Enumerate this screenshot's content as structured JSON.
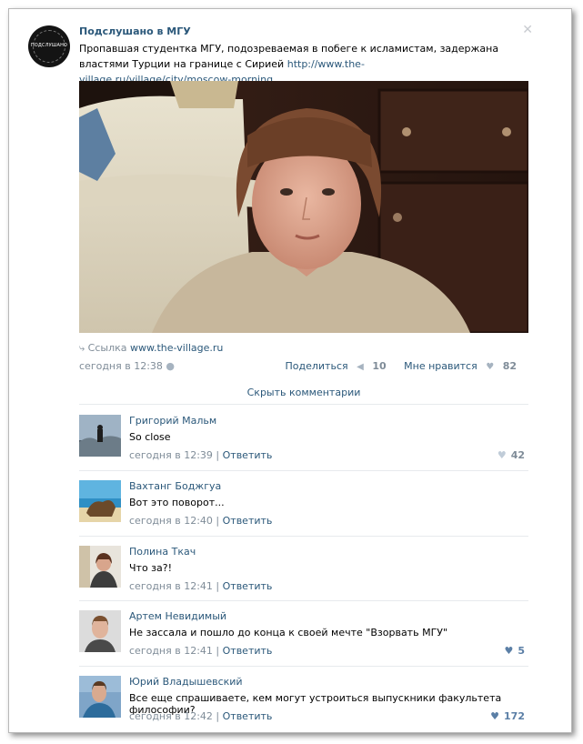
{
  "post": {
    "group_name": "Подслушано в МГУ",
    "avatar_text": "ПОДСЛУШАНО",
    "text": "Пропавшая студентка МГУ, подозреваемая в побеге к исламистам, задержана властями Турции на границе с Сирией ",
    "link_text": "http://www.the-village.ru/village/city/moscow-morning..",
    "link_label": "Ссылка",
    "link_domain": "www.the-village.ru",
    "time": "сегодня в 12:38",
    "share_label": "Поделиться",
    "share_count": "10",
    "like_label": "Мне нравится",
    "like_count": "82",
    "hide_comments": "Скрыть комментарии"
  },
  "comments": [
    {
      "author": "Григорий Мальм",
      "text": "So close",
      "time": "сегодня в 12:39",
      "reply": "Ответить",
      "likes": "42"
    },
    {
      "author": "Вахтанг Боджгуа",
      "text": "Вот это поворот...",
      "time": "сегодня в 12:40",
      "reply": "Ответить",
      "likes": ""
    },
    {
      "author": "Полина Ткач",
      "text": "Что за?!",
      "time": "сегодня в 12:41",
      "reply": "Ответить",
      "likes": ""
    },
    {
      "author": "Артем Невидимый",
      "text": "Не зассала и пошло до конца к своей мечте \"Взорвать МГУ\"",
      "time": "сегодня в 12:41",
      "reply": "Ответить",
      "likes": "5"
    },
    {
      "author": "Юрий Владышевский",
      "text": "Все еще спрашиваете, кем могут устроиться выпускники факультета философии?",
      "time": "сегодня в 12:42",
      "reply": "Ответить",
      "likes": "172"
    }
  ],
  "icons": {
    "close": "close-icon",
    "link": "link-icon",
    "share": "megaphone-icon",
    "like": "heart-icon",
    "apple": "apple-icon"
  },
  "colors": {
    "link": "#2b587a",
    "muted": "#7f8c98"
  }
}
